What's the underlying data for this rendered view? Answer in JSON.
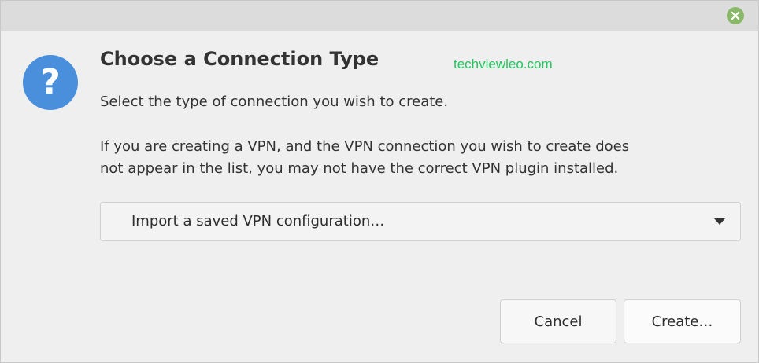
{
  "window": {
    "close_icon": "close-icon"
  },
  "dialog": {
    "icon": "question-icon",
    "icon_glyph": "?",
    "title": "Choose a Connection Type",
    "watermark": "techviewleo.com",
    "subtitle": "Select the type of connection you wish to create.",
    "info_line1": "If you are creating a VPN, and the VPN connection you wish to create does",
    "info_line2": "not appear in the list, you may not have the correct VPN plugin installed.",
    "connection_type": {
      "selected": "Import a saved VPN configuration…"
    }
  },
  "buttons": {
    "cancel": "Cancel",
    "create": "Create…"
  },
  "colors": {
    "accent_icon": "#4a8fdc",
    "close_button": "#8ab86a",
    "watermark": "#22c55e"
  }
}
